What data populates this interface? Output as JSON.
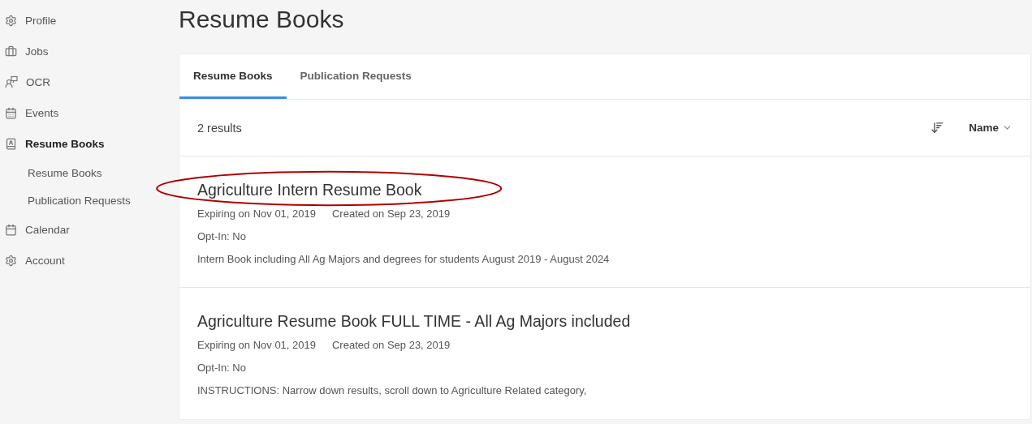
{
  "sidebar": {
    "items": [
      {
        "label": "Profile",
        "selected": false
      },
      {
        "label": "Jobs",
        "selected": false
      },
      {
        "label": "OCR",
        "selected": false
      },
      {
        "label": "Events",
        "selected": false
      },
      {
        "label": "Resume Books",
        "selected": true,
        "children": [
          {
            "label": "Resume Books",
            "selected": false
          },
          {
            "label": "Publication Requests",
            "selected": false
          }
        ]
      },
      {
        "label": "Calendar",
        "selected": false
      },
      {
        "label": "Account",
        "selected": false
      }
    ]
  },
  "page_title": "Resume Books",
  "tabs": [
    {
      "label": "Resume Books",
      "selected": true
    },
    {
      "label": "Publication Requests",
      "selected": false
    }
  ],
  "results_count": "2 results",
  "sort": {
    "label": "Name"
  },
  "items": [
    {
      "title": "Agriculture Intern Resume Book",
      "expiring": "Expiring on Nov 01, 2019",
      "created": "Created on Sep 23, 2019",
      "opt_in": "Opt-In: No",
      "description": "Intern Book including All Ag Majors and degrees for students August 2019 - August 2024",
      "circled": true
    },
    {
      "title": "Agriculture Resume Book FULL TIME - All Ag Majors included",
      "expiring": "Expiring on Nov 01, 2019",
      "created": "Created on Sep 23, 2019",
      "opt_in": "Opt-In: No",
      "description": "INSTRUCTIONS: Narrow down results, scroll down to Agriculture Related category,",
      "circled": false
    }
  ]
}
